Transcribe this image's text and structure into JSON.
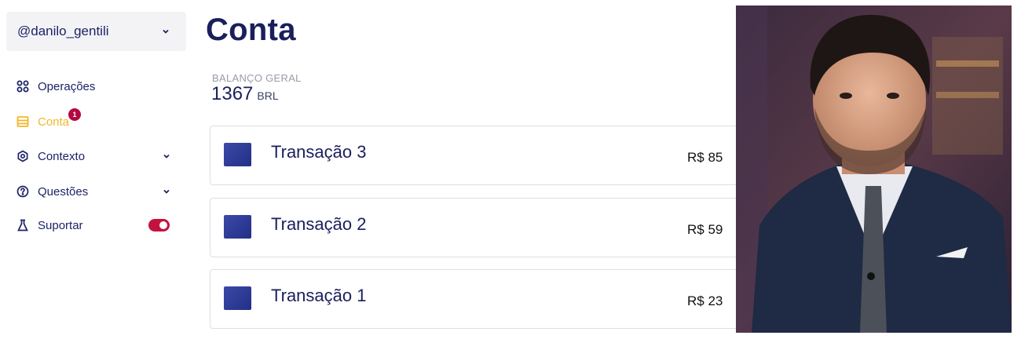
{
  "sidebar": {
    "account": {
      "handle": "@danilo_gentili"
    },
    "items": [
      {
        "label": "Operações",
        "icon": "grid-icon"
      },
      {
        "label": "Conta",
        "icon": "wallet-icon",
        "active": true,
        "badge": "1"
      },
      {
        "label": "Contexto",
        "icon": "settings-icon",
        "has_chevron": true
      },
      {
        "label": "Questões",
        "icon": "help-circle-icon",
        "has_chevron": true
      },
      {
        "label": "Suportar",
        "icon": "flask-icon",
        "toggle_on": true
      }
    ]
  },
  "main": {
    "title": "Conta",
    "balance": {
      "label": "BALANÇO GERAL",
      "value": "1367",
      "currency": "BRL"
    },
    "transactions": [
      {
        "name": "Transação 3",
        "amount": "R$ 85"
      },
      {
        "name": "Transação 2",
        "amount": "R$ 59"
      },
      {
        "name": "Transação 1",
        "amount": "R$ 23"
      }
    ]
  },
  "colors": {
    "primary_text": "#1a1f5c",
    "active_accent": "#f2b72a",
    "badge": "#b3083f",
    "toggle_on": "#c4123f"
  }
}
